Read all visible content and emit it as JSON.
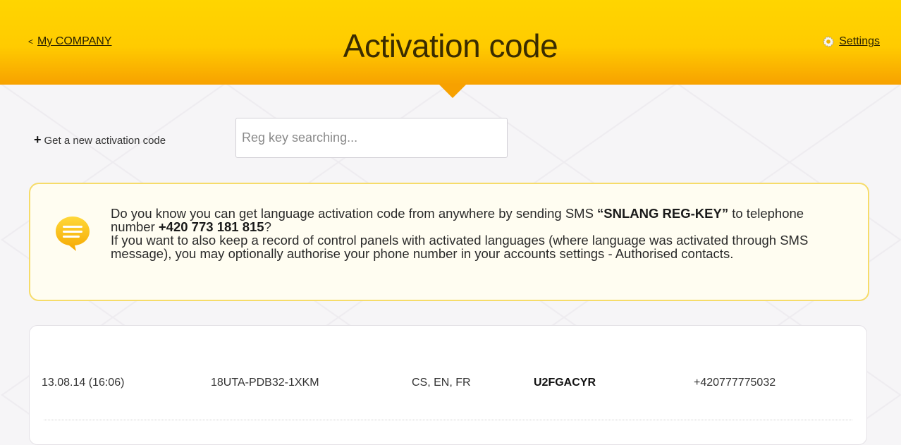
{
  "header": {
    "back_label": "My COMPANY",
    "back_chevron": "<",
    "title": "Activation code",
    "settings_label": "Settings",
    "settings_icon": "gear-icon"
  },
  "toolbar": {
    "new_code_plus": "+",
    "new_code_label": "Get a new activation code",
    "search_placeholder": "Reg key searching..."
  },
  "notice": {
    "icon": "chat-bubble-icon",
    "line1_a": "Do you know you can get language activation code from anywhere by sending SMS ",
    "sms_text": "“SNLANG REG-KEY”",
    "line1_b": " to telephone number ",
    "phone": "+420 773 181 815",
    "line1_c": "?",
    "line2": "If you want to also keep a record of control panels with activated languages (where language was activated through SMS message), you may optionally authorise your phone number in your accounts settings  - Authorised contacts."
  },
  "records": [
    {
      "date": "13.08.14 (16:06)",
      "reg_key": "18UTA-PDB32-1XKM",
      "languages": "CS, EN, FR",
      "code": "U2FGACYR",
      "phone": "+420777775032"
    }
  ],
  "colors": {
    "header_top": "#ffd500",
    "header_bottom": "#f7a100",
    "notice_border": "#f6dc6a",
    "bubble": "#ffc400"
  }
}
